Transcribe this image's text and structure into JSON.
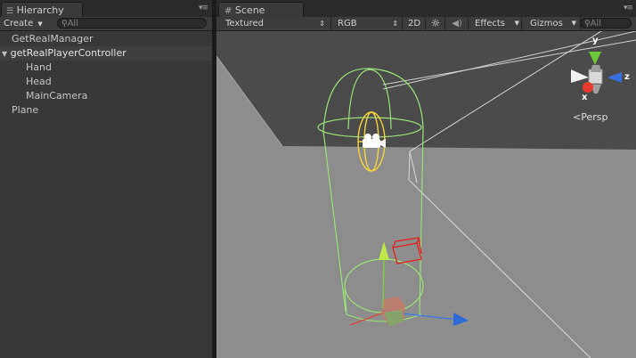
{
  "hierarchy": {
    "tab_label": "Hierarchy",
    "create_label": "Create",
    "search_placeholder": "All",
    "items": [
      {
        "label": "GetRealManager"
      },
      {
        "label": "getRealPlayerController"
      },
      {
        "label": "Hand"
      },
      {
        "label": "Head"
      },
      {
        "label": "MainCamera"
      },
      {
        "label": "Plane"
      }
    ]
  },
  "scene": {
    "tab_label": "Scene",
    "render_mode": "Textured",
    "color_mode": "RGB",
    "mode_2d": "2D",
    "effects_label": "Effects",
    "gizmos_label": "Gizmos",
    "search_placeholder": "All",
    "gizmo": {
      "x_label": "x",
      "y_label": "y",
      "z_label": "z",
      "projection_label": "Persp"
    }
  },
  "colors": {
    "viewport_background": "#4b4b4b",
    "ground_plane": "#8d8d8d",
    "collider_green": "#9be07a",
    "selection_yellow": "#f3d23d",
    "axis_x_red": "#e63b2e",
    "axis_y_green": "#7fd43b",
    "axis_z_blue": "#3a78e6"
  }
}
